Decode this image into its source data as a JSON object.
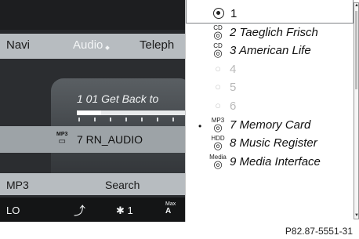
{
  "nav": {
    "items": [
      "Navi",
      "Audio",
      "Teleph"
    ],
    "active": "Audio"
  },
  "player": {
    "track_title": "1 01 Get Back to",
    "progress_fraction": 0.22,
    "source_icon_top": "MP3",
    "source_label": "7 RN_AUDIO"
  },
  "bottom_menu": {
    "items": [
      "MP3",
      "Search"
    ]
  },
  "status_bar": {
    "left": "LO",
    "fan_level": "1",
    "max_top": "Max",
    "max_bottom": "A"
  },
  "media_list": {
    "items": [
      {
        "number_label": "1",
        "icon": "radio-selected-icon",
        "icon_text": "",
        "style": "selected"
      },
      {
        "number_label": "2 Taeglich Frisch",
        "icon": "cd-icon",
        "icon_text": "CD",
        "style": "italic"
      },
      {
        "number_label": "3 American Life",
        "icon": "cd-icon",
        "icon_text": "CD",
        "style": "italic"
      },
      {
        "number_label": "4",
        "icon": "empty-slot-icon",
        "icon_text": "",
        "style": "disabled"
      },
      {
        "number_label": "5",
        "icon": "empty-slot-icon",
        "icon_text": "",
        "style": "disabled"
      },
      {
        "number_label": "6",
        "icon": "empty-slot-icon",
        "icon_text": "",
        "style": "disabled"
      },
      {
        "number_label": "7 Memory Card",
        "icon": "memory-card-icon",
        "icon_text": "MP3",
        "style": "italic",
        "active_bullet": "•"
      },
      {
        "number_label": "8 Music Register",
        "icon": "hdd-icon",
        "icon_text": "HDD",
        "style": "italic"
      },
      {
        "number_label": "9 Media Interface",
        "icon": "media-interface-icon",
        "icon_text": "Media",
        "style": "italic"
      }
    ]
  },
  "caption": "P82.87-5551-31",
  "colors": {
    "screen_bg": "#26282b",
    "menu_bar": "#b7bcc0",
    "overlay_bg": "#ffffff",
    "status_bar": "#141516"
  }
}
